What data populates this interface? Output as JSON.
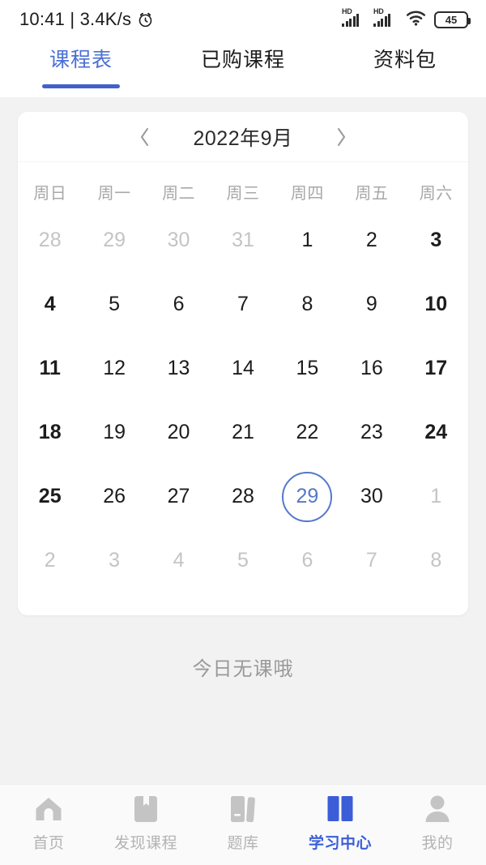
{
  "statusbar": {
    "time": "10:41",
    "separator": "|",
    "network_speed": "3.4K/s",
    "alarm_icon": "alarm-clock-icon",
    "signal1_label": "HD",
    "signal2_label": "HD",
    "wifi_icon": "wifi-icon",
    "battery_level": "45"
  },
  "tabs": [
    {
      "label": "课程表",
      "active": true
    },
    {
      "label": "已购课程",
      "active": false
    },
    {
      "label": "资料包",
      "active": false
    }
  ],
  "calendar": {
    "prev_icon": "chevron-left-icon",
    "next_icon": "chevron-right-icon",
    "title": "2022年9月",
    "weekdays": [
      "周日",
      "周一",
      "周二",
      "周三",
      "周四",
      "周五",
      "周六"
    ],
    "selected_day": "29",
    "accent_color": "#5478c9",
    "weeks": [
      [
        {
          "day": "28",
          "muted": true,
          "weekend": true
        },
        {
          "day": "29",
          "muted": true
        },
        {
          "day": "30",
          "muted": true
        },
        {
          "day": "31",
          "muted": true
        },
        {
          "day": "1"
        },
        {
          "day": "2"
        },
        {
          "day": "3",
          "weekend": true
        }
      ],
      [
        {
          "day": "4",
          "weekend": true
        },
        {
          "day": "5"
        },
        {
          "day": "6"
        },
        {
          "day": "7"
        },
        {
          "day": "8"
        },
        {
          "day": "9"
        },
        {
          "day": "10",
          "weekend": true
        }
      ],
      [
        {
          "day": "11",
          "weekend": true
        },
        {
          "day": "12"
        },
        {
          "day": "13"
        },
        {
          "day": "14"
        },
        {
          "day": "15"
        },
        {
          "day": "16"
        },
        {
          "day": "17",
          "weekend": true
        }
      ],
      [
        {
          "day": "18",
          "weekend": true
        },
        {
          "day": "19"
        },
        {
          "day": "20"
        },
        {
          "day": "21"
        },
        {
          "day": "22"
        },
        {
          "day": "23"
        },
        {
          "day": "24",
          "weekend": true
        }
      ],
      [
        {
          "day": "25",
          "weekend": true
        },
        {
          "day": "26"
        },
        {
          "day": "27"
        },
        {
          "day": "28"
        },
        {
          "day": "29",
          "selected": true
        },
        {
          "day": "30"
        },
        {
          "day": "1",
          "muted": true,
          "weekend": true
        }
      ],
      [
        {
          "day": "2",
          "muted": true,
          "weekend": true
        },
        {
          "day": "3",
          "muted": true
        },
        {
          "day": "4",
          "muted": true
        },
        {
          "day": "5",
          "muted": true
        },
        {
          "day": "6",
          "muted": true
        },
        {
          "day": "7",
          "muted": true
        },
        {
          "day": "8",
          "muted": true,
          "weekend": true
        }
      ]
    ]
  },
  "empty_state": {
    "text": "今日无课哦"
  },
  "bottomnav": [
    {
      "label": "首页",
      "icon": "home-icon",
      "active": false
    },
    {
      "label": "发现课程",
      "icon": "bookmark-icon",
      "active": false
    },
    {
      "label": "题库",
      "icon": "books-icon",
      "active": false
    },
    {
      "label": "学习中心",
      "icon": "open-book-icon",
      "active": true
    },
    {
      "label": "我的",
      "icon": "person-icon",
      "active": false
    }
  ]
}
